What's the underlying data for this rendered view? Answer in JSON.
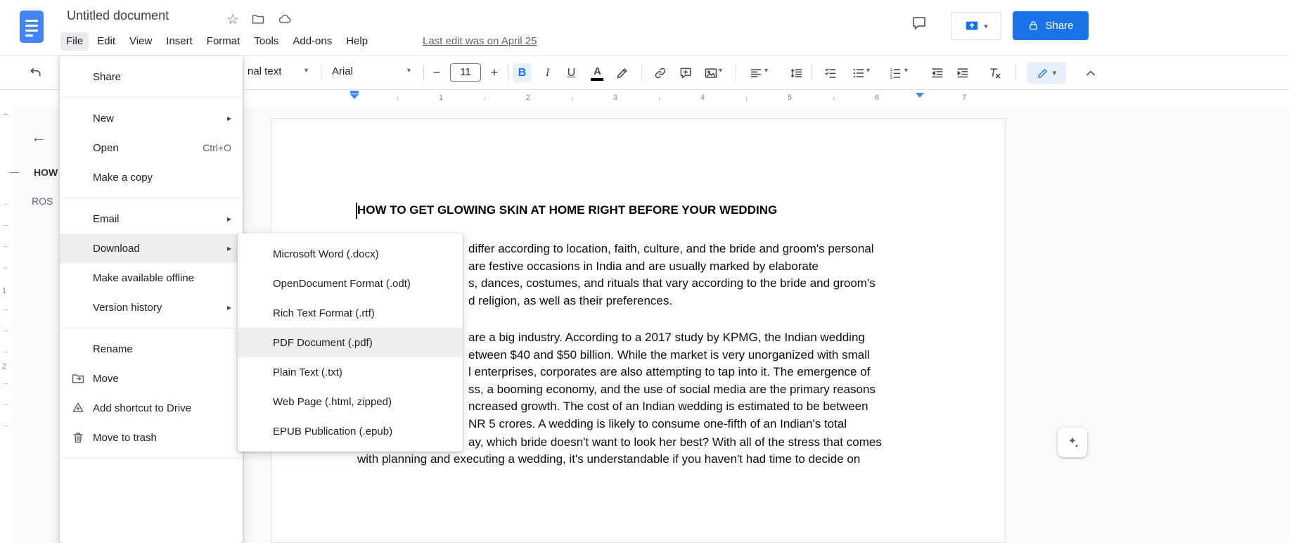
{
  "colors": {
    "accent": "#1a73e8",
    "brand": "#4285f4"
  },
  "glyphs": {
    "caret": "▾",
    "submenu_arrow": "▸",
    "star": "☆",
    "back_arrow": "←",
    "outline_dash": "—",
    "minus": "−",
    "plus": "+"
  },
  "header": {
    "doc_title": "Untitled document",
    "menus": [
      "File",
      "Edit",
      "View",
      "Insert",
      "Format",
      "Tools",
      "Add-ons",
      "Help"
    ],
    "last_edit": "Last edit was on April 25",
    "share_label": "Share"
  },
  "toolbar": {
    "styles_value": "nal text",
    "font_value": "Arial",
    "font_size": "11",
    "bold": "B",
    "italic": "I",
    "underline": "U",
    "text_color": "A"
  },
  "ruler": {
    "numbers": [
      "1",
      "2",
      "3",
      "4",
      "5",
      "6",
      "7"
    ],
    "vertical_numbers": [
      "1",
      "2"
    ]
  },
  "outline": {
    "items": [
      "HOW",
      "ROS"
    ]
  },
  "file_menu": {
    "items": [
      {
        "label": "Share"
      },
      {
        "label": "New",
        "submenu": true
      },
      {
        "label": "Open",
        "shortcut": "Ctrl+O"
      },
      {
        "label": "Make a copy"
      },
      {
        "label": "Email",
        "submenu": true
      },
      {
        "label": "Download",
        "submenu": true,
        "highlighted": true
      },
      {
        "label": "Make available offline"
      },
      {
        "label": "Version history",
        "submenu": true
      },
      {
        "label": "Rename"
      },
      {
        "label": "Move"
      },
      {
        "label": "Add shortcut to Drive"
      },
      {
        "label": "Move to trash"
      }
    ]
  },
  "download_menu": {
    "items": [
      {
        "label": "Microsoft Word (.docx)"
      },
      {
        "label": "OpenDocument Format (.odt)"
      },
      {
        "label": "Rich Text Format (.rtf)"
      },
      {
        "label": "PDF Document (.pdf)",
        "highlighted": true
      },
      {
        "label": "Plain Text (.txt)"
      },
      {
        "label": "Web Page (.html, zipped)"
      },
      {
        "label": "EPUB Publication (.epub)"
      }
    ]
  },
  "document": {
    "heading": "HOW TO GET GLOWING SKIN AT HOME RIGHT BEFORE YOUR WEDDING",
    "lines": [
      "differ according to location, faith, culture, and the bride and groom's personal",
      "are festive occasions in India and are usually marked by elaborate",
      "s, dances, costumes, and rituals that vary according to the bride and groom's",
      "d religion, as well as their preferences.",
      "are a big industry. According to a 2017 study by KPMG, the Indian wedding",
      "etween $40 and $50 billion. While the market is very unorganized with small",
      "l enterprises, corporates are also attempting to tap into it. The emergence of",
      "ss, a booming economy, and the use of social media are the primary reasons",
      "ncreased growth. The cost of an Indian wedding is estimated to be between",
      "NR 5 crores. A wedding is likely to consume one-fifth of an Indian's total",
      "ay, which bride doesn't want to look her best? With all of the stress that comes",
      "with planning and executing a wedding, it's understandable if you haven't had time to decide on"
    ]
  }
}
